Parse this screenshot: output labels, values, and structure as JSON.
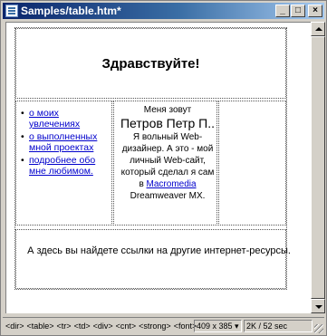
{
  "window": {
    "title": "Samples/table.htm*",
    "minimize_glyph": "_",
    "maximize_glyph": "□",
    "close_glyph": "×"
  },
  "page": {
    "greeting": "Здравствуйте!",
    "links": [
      "о моих увлечениях",
      "о выполненных мной проектах",
      "подробнее обо мне любимом."
    ],
    "bio": {
      "intro": "Меня зовут",
      "name": "Петров Петр П..",
      "text_after_name": " Я вольный Web-дизайнер. А это - мой личный Web-сайт, который сделал я сам в ",
      "product_link": "Macromedia",
      "text_after_link": " Dreamweaver MX."
    },
    "footer": "А здесь вы найдете ссылки на другие интернет-ресурсы."
  },
  "statusbar": {
    "tags": [
      "<dir>",
      "<table>",
      "<tr>",
      "<td>",
      "<div>",
      "<cnt>",
      "<strong>",
      "<font>"
    ],
    "window_size": "409 x 385",
    "download_info": "2K / 52 sec"
  }
}
